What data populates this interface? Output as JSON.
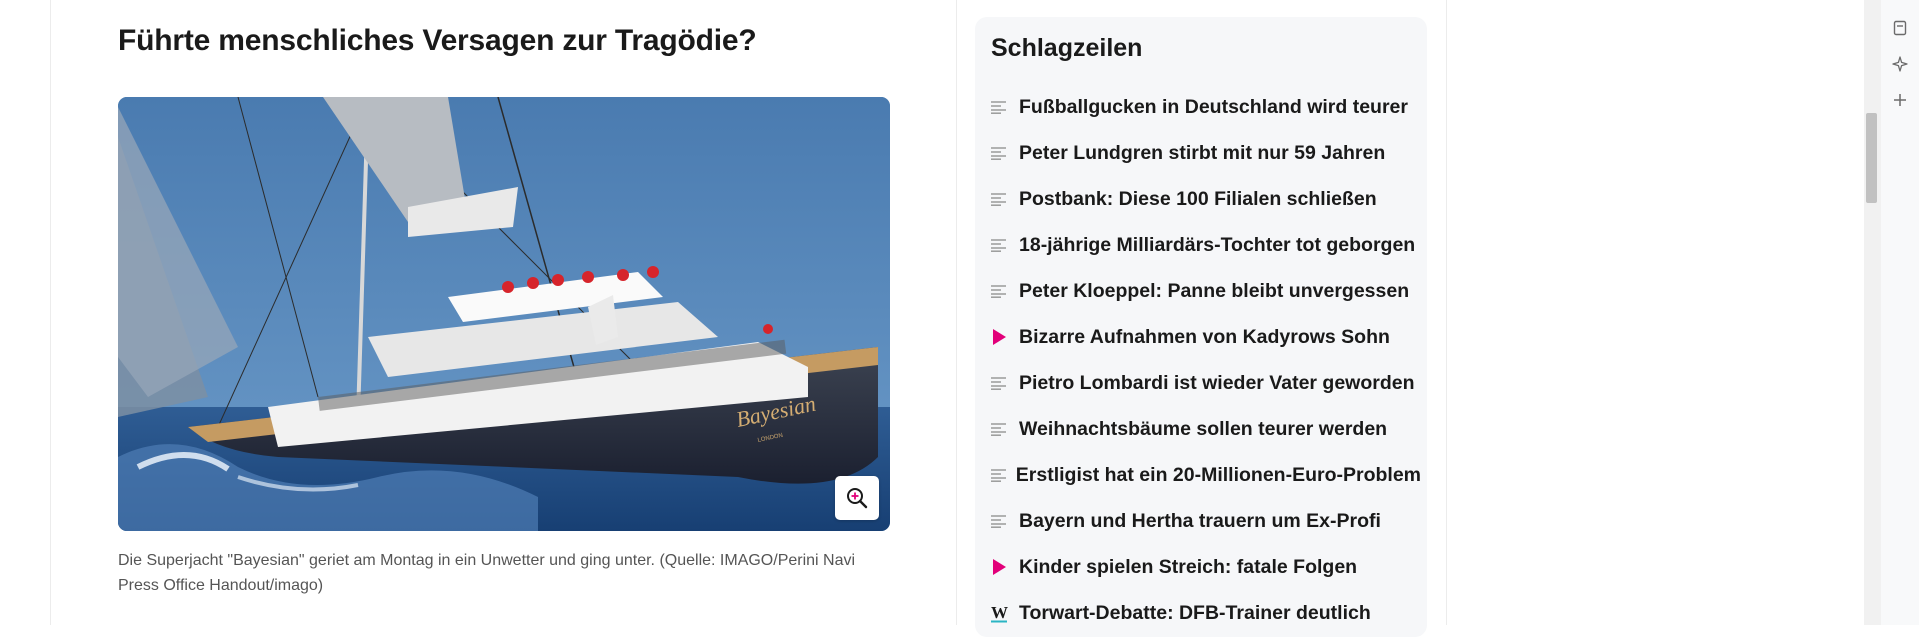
{
  "article": {
    "headline": "Führte menschliches Versagen zur Tragödie?",
    "image_alt": "Superyacht Bayesian",
    "yacht_name": "Bayesian",
    "yacht_port": "LONDON",
    "caption": "Die Superjacht \"Bayesian\" geriet am Montag in ein Unwetter und ging unter. (Quelle: IMAGO/Perini Navi Press Office Handout/imago)",
    "zoom_icon": "zoom-in-icon"
  },
  "sidebar": {
    "title": "Schlagzeilen",
    "items": [
      {
        "label": "Fußballgucken in Deutschland wird teurer",
        "icon": "text-icon"
      },
      {
        "label": "Peter Lundgren stirbt mit nur 59 Jahren",
        "icon": "text-icon"
      },
      {
        "label": "Postbank: Diese 100 Filialen schließen",
        "icon": "text-icon"
      },
      {
        "label": "18-jährige Milliardärs-Tochter tot geborgen",
        "icon": "text-icon"
      },
      {
        "label": "Peter Kloeppel: Panne bleibt unvergessen",
        "icon": "text-icon"
      },
      {
        "label": "Bizarre Aufnahmen von Kadyrows Sohn",
        "icon": "play-icon"
      },
      {
        "label": "Pietro Lombardi ist wieder Vater geworden",
        "icon": "text-icon"
      },
      {
        "label": "Weihnachtsbäume sollen teurer werden",
        "icon": "text-icon"
      },
      {
        "label": "Erstligist hat ein 20-Millionen-Euro-Problem",
        "icon": "text-icon"
      },
      {
        "label": "Bayern und Hertha trauern um Ex-Profi",
        "icon": "text-icon"
      },
      {
        "label": "Kinder spielen Streich: fatale Folgen",
        "icon": "play-icon"
      },
      {
        "label": "Torwart-Debatte: DFB-Trainer deutlich",
        "icon": "w-brand-icon"
      }
    ]
  },
  "browser_side": {
    "icons": [
      "bookmark-icon",
      "sparkle-pin-icon",
      "plus-icon"
    ]
  },
  "colors": {
    "accent_play": "#e2007a",
    "w_brand_underline": "#2bb5c4",
    "text": "#1a1a1a",
    "caption": "#555555",
    "sidebar_bg": "#f6f7f9"
  }
}
